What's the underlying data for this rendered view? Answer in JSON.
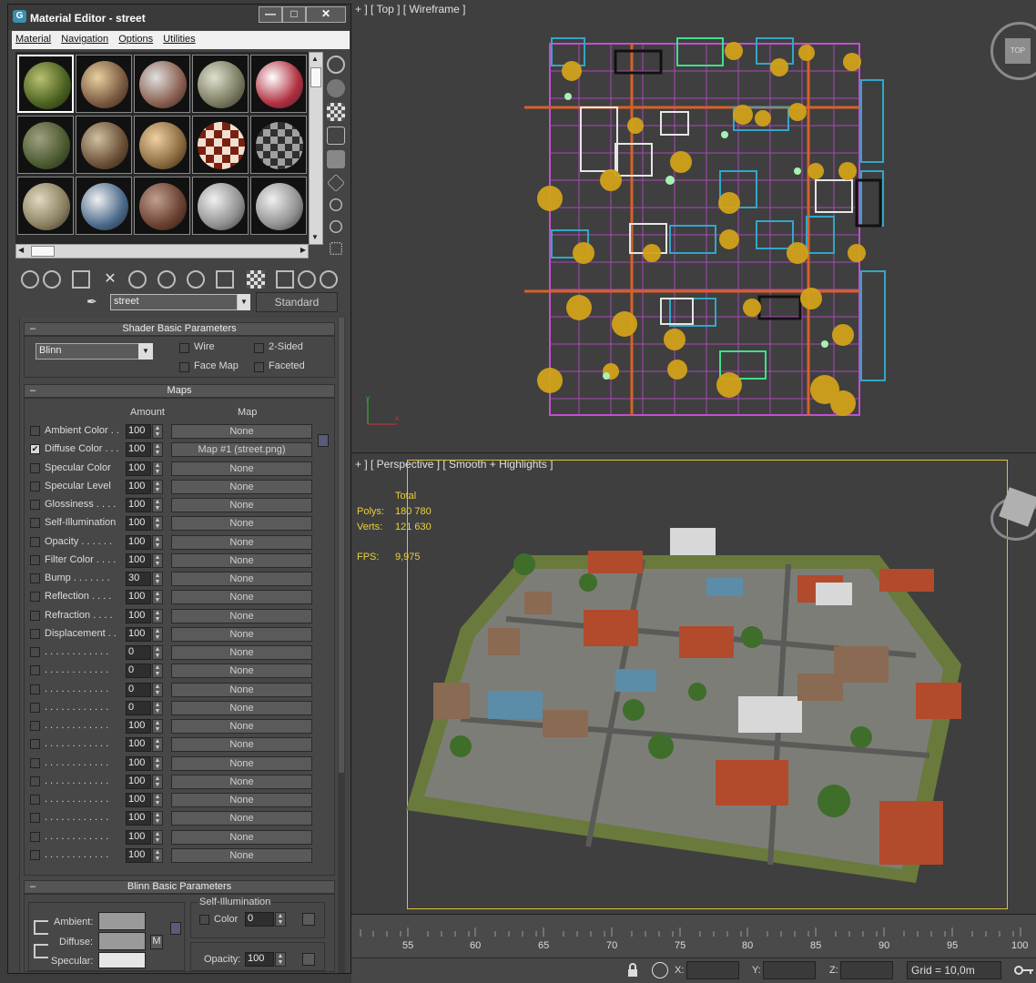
{
  "material_editor": {
    "title": "Material Editor - street",
    "menu": [
      "Material",
      "Navigation",
      "Options",
      "Utilities"
    ],
    "material_name": "street",
    "material_type": "Standard",
    "shader_rollout": {
      "title": "Shader Basic Parameters",
      "shader": "Blinn",
      "options": [
        {
          "label": "Wire",
          "checked": false
        },
        {
          "label": "2-Sided",
          "checked": false
        },
        {
          "label": "Face Map",
          "checked": false
        },
        {
          "label": "Faceted",
          "checked": false
        }
      ]
    },
    "maps_rollout": {
      "title": "Maps",
      "col_amount": "Amount",
      "col_map": "Map",
      "rows": [
        {
          "label": "Ambient Color . .",
          "checked": false,
          "amount": "100",
          "map": "None"
        },
        {
          "label": "Diffuse Color . . .",
          "checked": true,
          "amount": "100",
          "map": "Map #1 (street.png)"
        },
        {
          "label": "Specular Color",
          "checked": false,
          "amount": "100",
          "map": "None"
        },
        {
          "label": "Specular Level",
          "checked": false,
          "amount": "100",
          "map": "None"
        },
        {
          "label": "Glossiness . . . .",
          "checked": false,
          "amount": "100",
          "map": "None"
        },
        {
          "label": "Self-Illumination",
          "checked": false,
          "amount": "100",
          "map": "None"
        },
        {
          "label": "Opacity . . . . . .",
          "checked": false,
          "amount": "100",
          "map": "None"
        },
        {
          "label": "Filter Color . . . .",
          "checked": false,
          "amount": "100",
          "map": "None"
        },
        {
          "label": "Bump . . . . . . .",
          "checked": false,
          "amount": "30",
          "map": "None"
        },
        {
          "label": "Reflection . . . .",
          "checked": false,
          "amount": "100",
          "map": "None"
        },
        {
          "label": "Refraction . . . .",
          "checked": false,
          "amount": "100",
          "map": "None"
        },
        {
          "label": "Displacement . .",
          "checked": false,
          "amount": "100",
          "map": "None"
        },
        {
          "label": ". . . . . . . . . . . .",
          "checked": false,
          "amount": "0",
          "map": "None"
        },
        {
          "label": ". . . . . . . . . . . .",
          "checked": false,
          "amount": "0",
          "map": "None"
        },
        {
          "label": ". . . . . . . . . . . .",
          "checked": false,
          "amount": "0",
          "map": "None"
        },
        {
          "label": ". . . . . . . . . . . .",
          "checked": false,
          "amount": "0",
          "map": "None"
        },
        {
          "label": ". . . . . . . . . . . .",
          "checked": false,
          "amount": "100",
          "map": "None"
        },
        {
          "label": ". . . . . . . . . . . .",
          "checked": false,
          "amount": "100",
          "map": "None"
        },
        {
          "label": ". . . . . . . . . . . .",
          "checked": false,
          "amount": "100",
          "map": "None"
        },
        {
          "label": ". . . . . . . . . . . .",
          "checked": false,
          "amount": "100",
          "map": "None"
        },
        {
          "label": ". . . . . . . . . . . .",
          "checked": false,
          "amount": "100",
          "map": "None"
        },
        {
          "label": ". . . . . . . . . . . .",
          "checked": false,
          "amount": "100",
          "map": "None"
        },
        {
          "label": ". . . . . . . . . . . .",
          "checked": false,
          "amount": "100",
          "map": "None"
        },
        {
          "label": ". . . . . . . . . . . .",
          "checked": false,
          "amount": "100",
          "map": "None"
        }
      ]
    },
    "blinn_rollout": {
      "title": "Blinn Basic Parameters",
      "ambient_label": "Ambient:",
      "diffuse_label": "Diffuse:",
      "specular_label": "Specular:",
      "diffuse_map_button": "M",
      "self_illum_title": "Self-Illumination",
      "self_illum_color_label": "Color",
      "self_illum_value": "0",
      "opacity_label": "Opacity:",
      "opacity_value": "100"
    },
    "colors": {
      "ambient": "#9a9a9a",
      "diffuse": "#9a9a9a",
      "specular": "#e6e6e6"
    }
  },
  "viewports": {
    "top_label": "+ ] [ Top ] [ Wireframe ]",
    "perspective_label": "+ ] [ Perspective ] [ Smooth + Highlights ]",
    "viewcube_top": "TOP",
    "stats": {
      "total_label": "Total",
      "polys_label": "Polys:",
      "polys_value": "180 780",
      "verts_label": "Verts:",
      "verts_value": "121 630",
      "fps_label": "FPS:",
      "fps_value": "9,975"
    }
  },
  "timeline": {
    "ticks": [
      "55",
      "60",
      "65",
      "70",
      "75",
      "80",
      "85",
      "90",
      "95",
      "100"
    ]
  },
  "statusbar": {
    "x_label": "X:",
    "y_label": "Y:",
    "z_label": "Z:",
    "x_value": "",
    "y_value": "",
    "z_value": "",
    "grid": "Grid = 10,0m"
  }
}
